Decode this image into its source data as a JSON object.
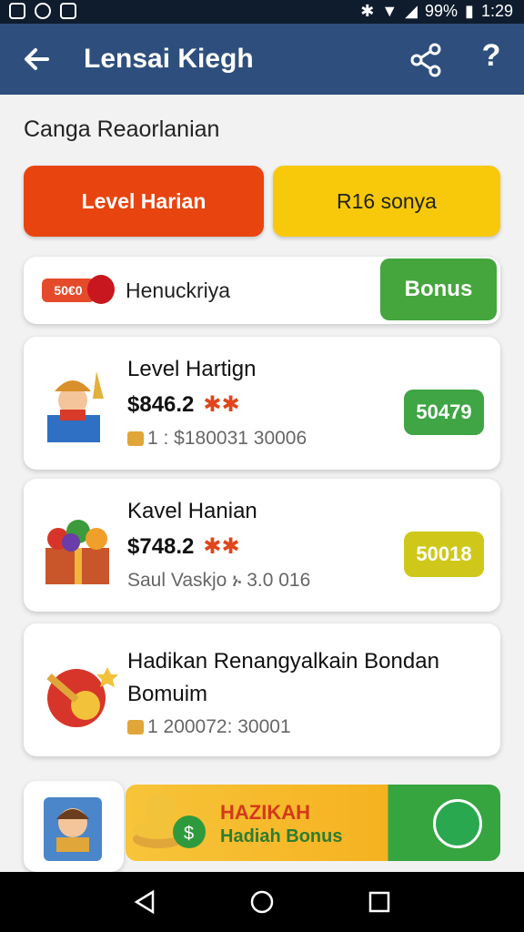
{
  "status": {
    "battery": "99%",
    "time": "1:29"
  },
  "appbar": {
    "title": "Lensai Kiegh"
  },
  "section_title": "Canga Reaorlanian",
  "tabs": [
    {
      "label": "Level Harian"
    },
    {
      "label": "R16 sonya"
    }
  ],
  "bonus_row": {
    "chip": "50€0",
    "text": "Henuckriya",
    "button": "Bonus"
  },
  "tasks": [
    {
      "name": "Level Hartign",
      "price": "$846.2",
      "stars": "✱✱",
      "meta": "1 : $180031 30006",
      "reward": "50479"
    },
    {
      "name": "Kavel Hanian",
      "price": "$748.2",
      "stars": "✱✱",
      "meta": "Saul Vaskjo ኑ 3.0 016",
      "reward": "50018"
    },
    {
      "name": "Hadikan Renangyalkain Bondan Bomuim",
      "meta": "1  200072: 30001"
    }
  ],
  "banner": {
    "title": "HAZIKAH",
    "subtitle_a": "Hadiah",
    "subtitle_b": "Bonus"
  },
  "colors": {
    "appbar": "#2e4f7d",
    "red": "#e8440f",
    "yellow": "#f7c90a",
    "green": "#44a63d"
  }
}
